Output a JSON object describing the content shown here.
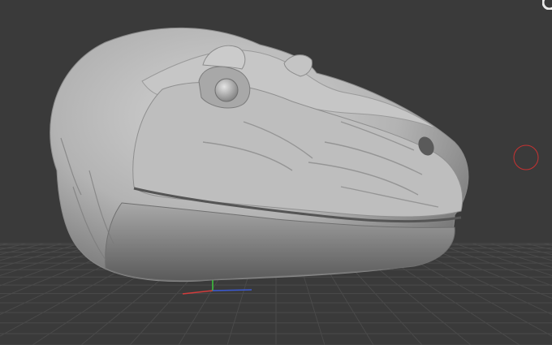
{
  "app": {
    "type": "3d-sculpting-viewport"
  },
  "viewport": {
    "background_color": "#3a3a3a",
    "grid_color": "#4a4a4a",
    "grid_visible": true,
    "model": {
      "name": "",
      "material_color": "#b9b9b9",
      "shape": "dinosaur-head-sculpt"
    },
    "axis_gizmo": {
      "x_color": "#d23c3c",
      "y_color": "#3cc83c",
      "z_color": "#3c5ad2"
    },
    "brush_cursor": {
      "color": "#c83232",
      "icon": "brush-circle-icon"
    },
    "corner_widget": {
      "icon": "navigation-widget-icon",
      "color": "#e8e8e8"
    }
  }
}
